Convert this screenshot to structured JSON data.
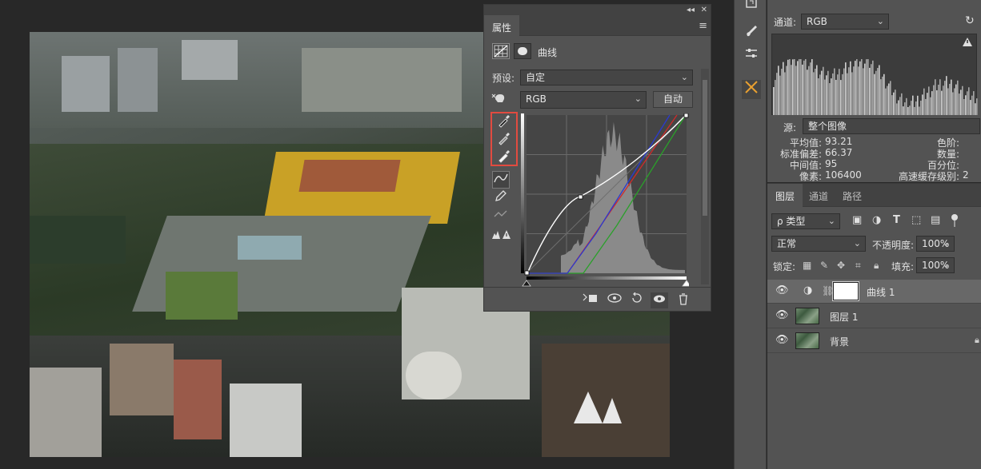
{
  "properties_panel": {
    "collapse_glyph": "◂◂",
    "close_glyph": "✕",
    "tab_label": "属性",
    "menu_glyph": "≡",
    "adjustment_title": "曲线",
    "preset_label": "预设:",
    "preset_value": "自定",
    "channel_value": "RGB",
    "auto_button": "自动",
    "histogram_gray": "#8a8a8a",
    "curve_colors": {
      "rgb": "#ffffff",
      "red": "#d02a2a",
      "green": "#2aa02a",
      "blue": "#2a3ad0"
    },
    "tools": [
      "hand-target-icon",
      "black-eyedropper-icon",
      "gray-eyedropper-icon",
      "white-eyedropper-icon",
      "curve-point-icon",
      "pencil-icon",
      "smooth-icon",
      "clipping-warning-icon"
    ],
    "bottom_icons": [
      "clip-to-layer-icon",
      "view-previous-icon",
      "reset-icon",
      "visibility-icon",
      "trash-icon"
    ]
  },
  "histogram_panel": {
    "channel_label": "通道:",
    "channel_value": "RGB",
    "source_label": "源:",
    "source_value": "整个图像",
    "stats_left": [
      {
        "label": "平均值:",
        "value": "93.21"
      },
      {
        "label": "标准偏差:",
        "value": "66.37"
      },
      {
        "label": "中间值:",
        "value": "95"
      },
      {
        "label": "像素:",
        "value": "106400"
      }
    ],
    "stats_right": [
      {
        "label": "色阶:",
        "value": ""
      },
      {
        "label": "数量:",
        "value": ""
      },
      {
        "label": "百分位:",
        "value": ""
      },
      {
        "label": "高速缓存级别:",
        "value": "2"
      }
    ]
  },
  "layers_panel": {
    "tabs": [
      "图层",
      "通道",
      "路径"
    ],
    "filter_label": "ρ 类型",
    "blend_mode": "正常",
    "opacity_label": "不透明度:",
    "opacity_value": "100%",
    "lock_label": "锁定:",
    "fill_label": "填充:",
    "fill_value": "100%",
    "layers": [
      {
        "name": "曲线 1",
        "type": "adjustment",
        "selected": true
      },
      {
        "name": "图层 1",
        "type": "image",
        "selected": false
      },
      {
        "name": "背景",
        "type": "image",
        "selected": false
      }
    ]
  },
  "toolstrip": [
    "panel-toggle-icon",
    "brush-settings-icon",
    "brush-presets-icon",
    "adjustments-icon",
    "tool-presets-icon"
  ]
}
